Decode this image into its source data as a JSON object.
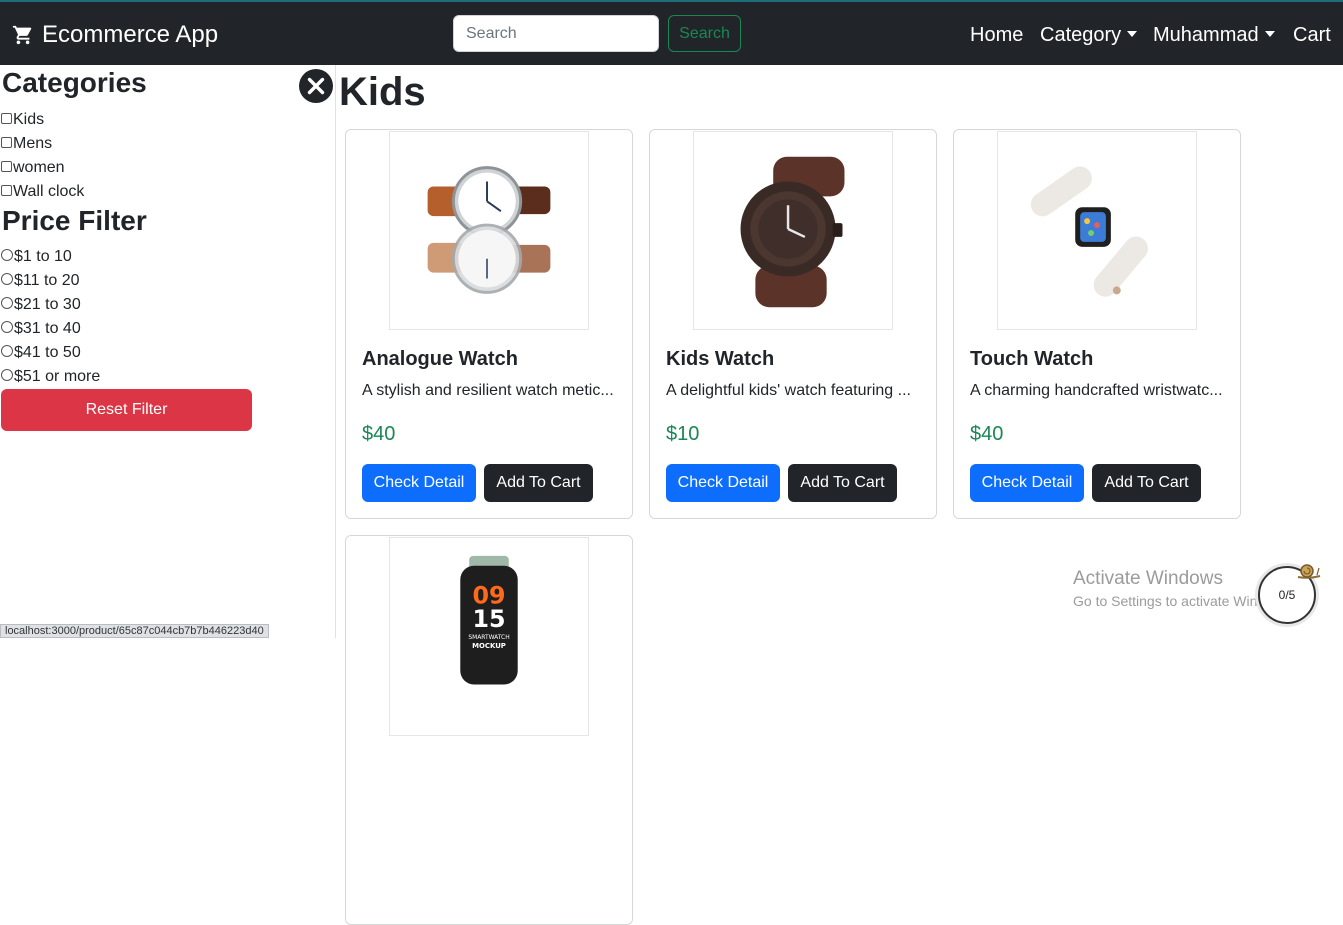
{
  "navbar": {
    "brand": "Ecommerce App",
    "brand_icon": "cart-icon",
    "search_placeholder": "Search",
    "search_value": "",
    "search_button": "Search",
    "links": {
      "home": "Home",
      "category": "Category",
      "user": "Muhammad",
      "cart": "Cart"
    }
  },
  "sidebar": {
    "categories_title": "Categories",
    "categories": [
      "Kids",
      "Mens",
      "women",
      "Wall clock"
    ],
    "price_title": "Price Filter",
    "prices": [
      "$1 to 10",
      "$11 to 20",
      "$21 to 30",
      "$31 to 40",
      "$41 to 50",
      "$51 or more"
    ],
    "reset_label": "Reset Filter",
    "close_icon": "close-circle-icon"
  },
  "main": {
    "title": "Kids",
    "products": [
      {
        "name": "Analogue Watch",
        "description": "A stylish and resilient watch metic...",
        "price": "$40",
        "detail_label": "Check Detail",
        "cart_label": "Add To Cart",
        "image": "analogue-watch-image"
      },
      {
        "name": "Kids Watch",
        "description": "A delightful kids' watch featuring ...",
        "price": "$10",
        "detail_label": "Check Detail",
        "cart_label": "Add To Cart",
        "image": "kids-watch-image"
      },
      {
        "name": "Touch Watch",
        "description": "A charming handcrafted wristwatc...",
        "price": "$40",
        "detail_label": "Check Detail",
        "cart_label": "Add To Cart",
        "image": "touch-watch-image"
      },
      {
        "name": "",
        "description": "",
        "price": "",
        "image": "smartwatch-image",
        "image_text": [
          "09",
          "15",
          "SMARTWATCH",
          "MOCKUP"
        ]
      }
    ]
  },
  "overlay": {
    "activate_title": "Activate Windows",
    "activate_sub": "Go to Settings to activate Windows.",
    "counter": "0/5",
    "status_url": "localhost:3000/product/65c87c044cb7b7b446223d40"
  },
  "colors": {
    "navbar": "#212529",
    "primary": "#0d6efd",
    "success": "#198754",
    "danger": "#dc3545",
    "dark": "#212529"
  }
}
